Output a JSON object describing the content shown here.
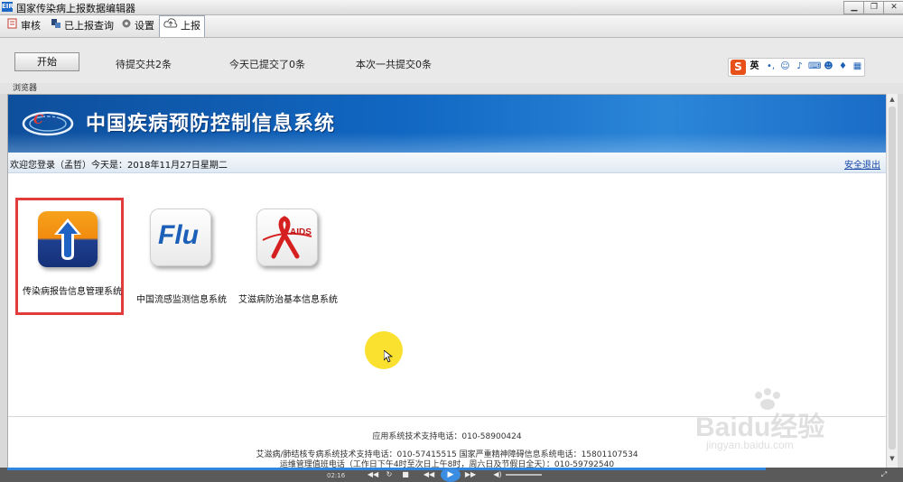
{
  "window": {
    "title": "国家传染病上报数据编辑器",
    "icon_text": "EIR",
    "controls": {
      "minimize": "▁",
      "restore": "❐",
      "close": "✕"
    }
  },
  "toolbar": {
    "items": [
      {
        "label": "审核",
        "icon": "review-icon"
      },
      {
        "label": "已上报查询",
        "icon": "query-icon"
      },
      {
        "label": "设置",
        "icon": "gear-icon"
      },
      {
        "label": "上报",
        "icon": "cloud-upload-icon",
        "active": true
      }
    ]
  },
  "action_bar": {
    "start_label": "开始",
    "pending": "待提交共2条",
    "today": "今天已提交了0条",
    "this_time": "本次一共提交0条"
  },
  "ime": {
    "logo": "S",
    "lang": "英",
    "icons": [
      "punctuation-icon",
      "emoji-icon",
      "mic-icon",
      "keyboard-icon",
      "user-icon",
      "shirt-icon",
      "grid-icon"
    ]
  },
  "browser_label": "浏览器",
  "banner": {
    "logo_text": "CDC",
    "title": "中国疾病预防控制信息系统"
  },
  "welcome": {
    "text": "欢迎您登录（孟哲）今天是：2018年11月27日星期二",
    "logout": "安全退出"
  },
  "apps": [
    {
      "label": "传染病报告信息管理系统",
      "tile": "upload-arrow",
      "selected": true
    },
    {
      "label": "中国流感监测信息系统",
      "tile_text": "Flu"
    },
    {
      "label": "艾滋病防治基本信息系统",
      "tile_text": "AIDS"
    }
  ],
  "footer": {
    "line1": "应用系统技术支持电话：010-58900424",
    "line2": "艾滋病/肺结核专病系统技术支持电话：010-57415515 国家严重精神障碍信息系统电话：15801107534",
    "line3": "运维管理值班电话（工作日下午4时至次日上午8时，周六日及节假日全天）：010-59792540"
  },
  "video": {
    "time": "02:16"
  },
  "watermark": {
    "text": "Baidu经验",
    "url": "jingyan.baidu.com"
  },
  "colors": {
    "accent": "#1167c2",
    "selection": "#e23b3b",
    "cursor_halo": "#fadc0a"
  }
}
